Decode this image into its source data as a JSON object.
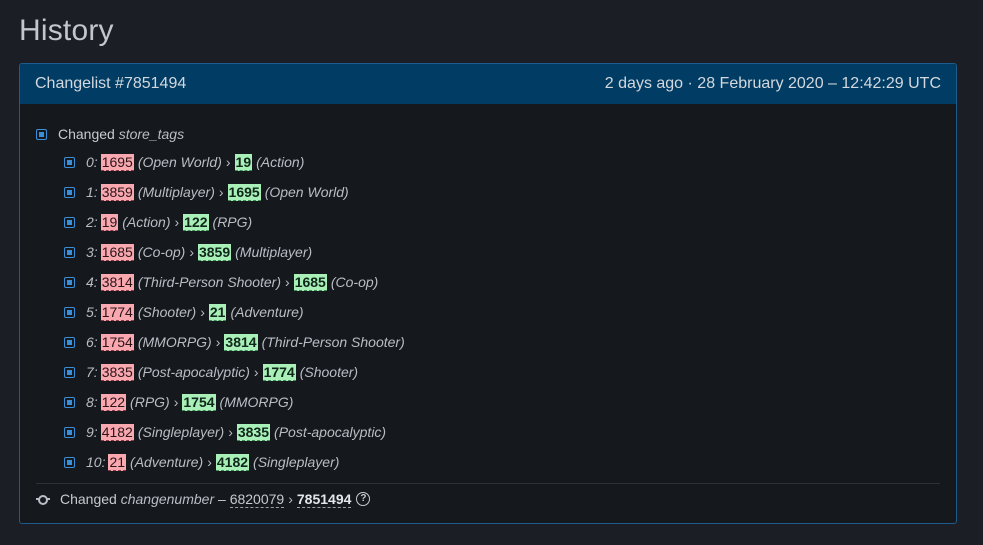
{
  "page": {
    "title": "History"
  },
  "changelist": {
    "id_label": "Changelist #7851494",
    "time_label": "2 days ago · 28 February 2020 – 12:42:29 UTC"
  },
  "store_tags": {
    "changed_label": "Changed",
    "key": "store_tags",
    "arrow": "›",
    "items": [
      {
        "index": "0:",
        "old_id": "1695",
        "old_name": "(Open World)",
        "new_id": "19",
        "new_name": "(Action)"
      },
      {
        "index": "1:",
        "old_id": "3859",
        "old_name": "(Multiplayer)",
        "new_id": "1695",
        "new_name": "(Open World)"
      },
      {
        "index": "2:",
        "old_id": "19",
        "old_name": "(Action)",
        "new_id": "122",
        "new_name": "(RPG)"
      },
      {
        "index": "3:",
        "old_id": "1685",
        "old_name": "(Co-op)",
        "new_id": "3859",
        "new_name": "(Multiplayer)"
      },
      {
        "index": "4:",
        "old_id": "3814",
        "old_name": "(Third-Person Shooter)",
        "new_id": "1685",
        "new_name": "(Co-op)"
      },
      {
        "index": "5:",
        "old_id": "1774",
        "old_name": "(Shooter)",
        "new_id": "21",
        "new_name": "(Adventure)"
      },
      {
        "index": "6:",
        "old_id": "1754",
        "old_name": "(MMORPG)",
        "new_id": "3814",
        "new_name": "(Third-Person Shooter)"
      },
      {
        "index": "7:",
        "old_id": "3835",
        "old_name": "(Post-apocalyptic)",
        "new_id": "1774",
        "new_name": "(Shooter)"
      },
      {
        "index": "8:",
        "old_id": "122",
        "old_name": "(RPG)",
        "new_id": "1754",
        "new_name": "(MMORPG)"
      },
      {
        "index": "9:",
        "old_id": "4182",
        "old_name": "(Singleplayer)",
        "new_id": "3835",
        "new_name": "(Post-apocalyptic)"
      },
      {
        "index": "10:",
        "old_id": "21",
        "old_name": "(Adventure)",
        "new_id": "4182",
        "new_name": "(Singleplayer)"
      }
    ]
  },
  "changenumber": {
    "changed_label": "Changed",
    "key": "changenumber",
    "dash": "–",
    "old_value": "6820079",
    "arrow": "›",
    "new_value": "7851494",
    "help_glyph": "?"
  },
  "icons": {
    "change_item": "checkbox-square-icon",
    "commit": "git-commit-icon",
    "help": "question-circle-icon"
  },
  "colors": {
    "background": "#1b1e24",
    "header": "#003c63",
    "border": "#1e5c8d",
    "removed": "#f9a8b0",
    "added": "#a8f0b8",
    "accent": "#3b8fd9"
  }
}
